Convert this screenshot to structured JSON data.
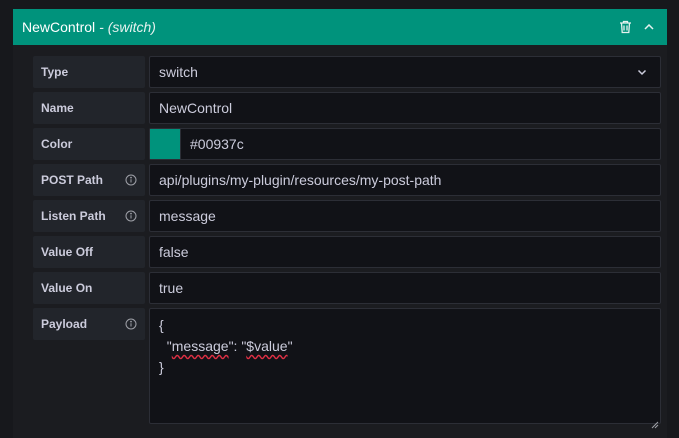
{
  "header": {
    "title": "NewControl",
    "subtitle": "- (switch)",
    "icons": [
      "trash-icon",
      "chevron-up-icon"
    ]
  },
  "rows": [
    {
      "label": "Type",
      "value": "switch",
      "kind": "select"
    },
    {
      "label": "Name",
      "value": "NewControl",
      "kind": "text"
    },
    {
      "label": "Color",
      "value": "#00937c",
      "kind": "color"
    },
    {
      "label": "POST Path",
      "value": "api/plugins/my-plugin/resources/my-post-path",
      "kind": "text",
      "info": true
    },
    {
      "label": "Listen Path",
      "value": "message",
      "kind": "text",
      "info": true
    },
    {
      "label": "Value Off",
      "value": "false",
      "kind": "text"
    },
    {
      "label": "Value On",
      "value": "true",
      "kind": "text"
    }
  ],
  "payload": {
    "label": "Payload",
    "lines": [
      "{",
      "\"",
      "message",
      "\": \"",
      "$value",
      "\"",
      "}"
    ]
  },
  "colors": {
    "accent": "#00937c",
    "background": "#17181c",
    "field_bg": "#111217",
    "label_bg": "#22252b",
    "text": "#ccccdc"
  }
}
